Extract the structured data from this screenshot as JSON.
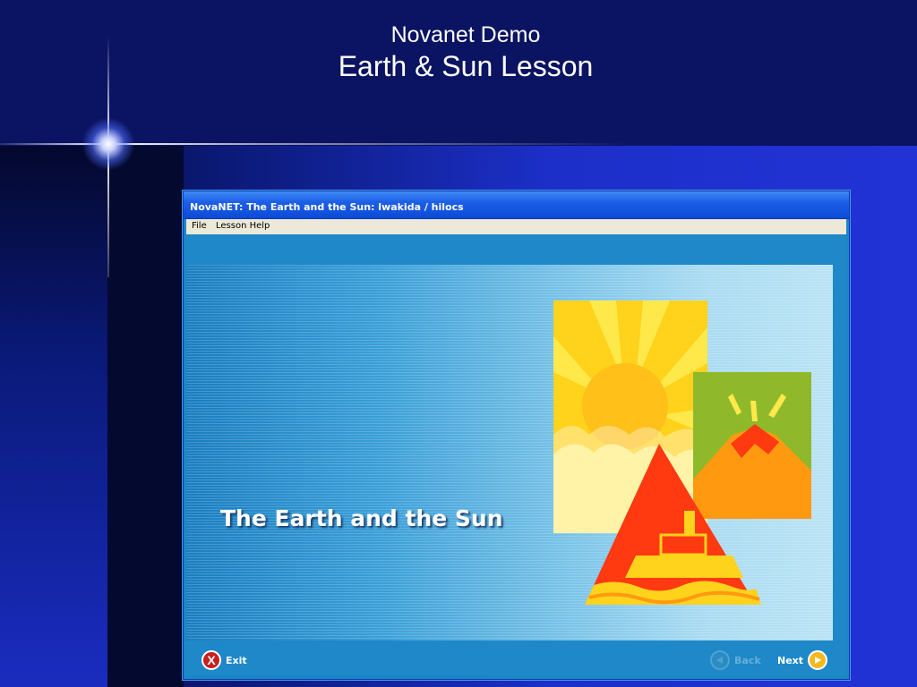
{
  "slide": {
    "subtitle": "Novanet Demo",
    "title": "Earth & Sun Lesson"
  },
  "window": {
    "title": "NovaNET: The Earth and the Sun: lwakida / hilocs",
    "menu": [
      {
        "label": "File"
      },
      {
        "label": "Lesson Help"
      }
    ]
  },
  "lesson": {
    "title": "The Earth and the Sun"
  },
  "nav": {
    "exit_label": "Exit",
    "exit_icon": "x-circle-icon",
    "back_label": "Back",
    "back_icon": "back-arrow-icon",
    "back_enabled": false,
    "next_label": "Next",
    "next_icon": "next-arrow-icon"
  },
  "colors": {
    "titlebar": "#0c4ad6",
    "exit": "#c8201e",
    "next": "#f4b820",
    "sun": "#ffd21c",
    "volcano_bg": "#8fb92a",
    "pyramid": "#ff3a10"
  }
}
